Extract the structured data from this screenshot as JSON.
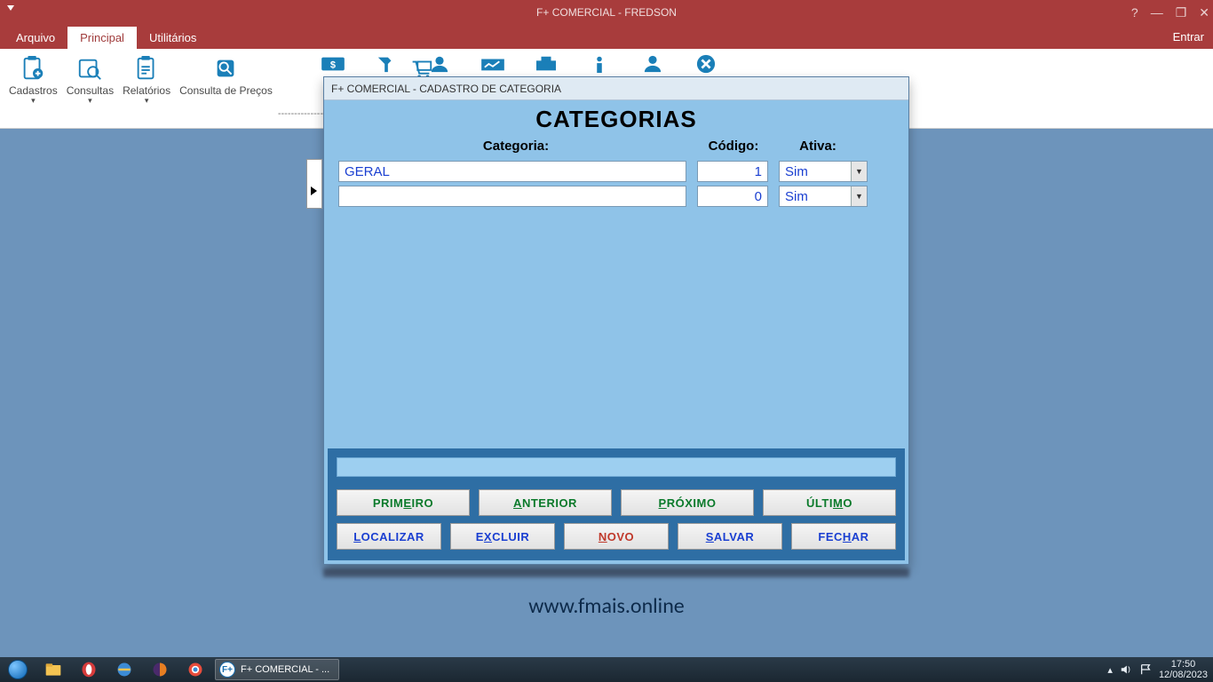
{
  "titlebar": {
    "title": "F+ COMERCIAL - FREDSON"
  },
  "menutabs": {
    "arquivo": "Arquivo",
    "principal": "Principal",
    "utilitarios": "Utilitários",
    "entrar": "Entrar"
  },
  "ribbon": {
    "cadastros": "Cadastros",
    "consultas": "Consultas",
    "relatorios": "Relatórios",
    "consulta_precos": "Consulta de Preços",
    "vendas": "Vendas",
    "dashes": "-------------------------------------"
  },
  "dialog": {
    "title": "F+ COMERCIAL - CADASTRO DE CATEGORIA",
    "heading": "CATEGORIAS",
    "headers": {
      "categoria": "Categoria:",
      "codigo": "Código:",
      "ativa": "Ativa:"
    },
    "rows": [
      {
        "categoria": "GERAL",
        "codigo": "1",
        "ativa": "Sim"
      },
      {
        "categoria": "",
        "codigo": "0",
        "ativa": "Sim"
      }
    ],
    "buttons": {
      "primeiro_pre": "PRIM",
      "primeiro_u": "E",
      "primeiro_post": "IRO",
      "anterior_u": "A",
      "anterior_post": "NTERIOR",
      "proximo_u": "P",
      "proximo_post": "RÓXIMO",
      "ultimo_pre": "ÚLTI",
      "ultimo_u": "M",
      "ultimo_post": "O",
      "localizar_u": "L",
      "localizar_post": "OCALIZAR",
      "excluir_pre": "E",
      "excluir_u": "X",
      "excluir_post": "CLUIR",
      "novo_u": "N",
      "novo_post": "OVO",
      "salvar_u": "S",
      "salvar_post": "ALVAR",
      "fechar_pre": "FEC",
      "fechar_u": "H",
      "fechar_post": "AR"
    }
  },
  "url": "www.fmais.online",
  "taskbar": {
    "app_label": "F+ COMERCIAL - ...",
    "time": "17:50",
    "date": "12/08/2023"
  }
}
